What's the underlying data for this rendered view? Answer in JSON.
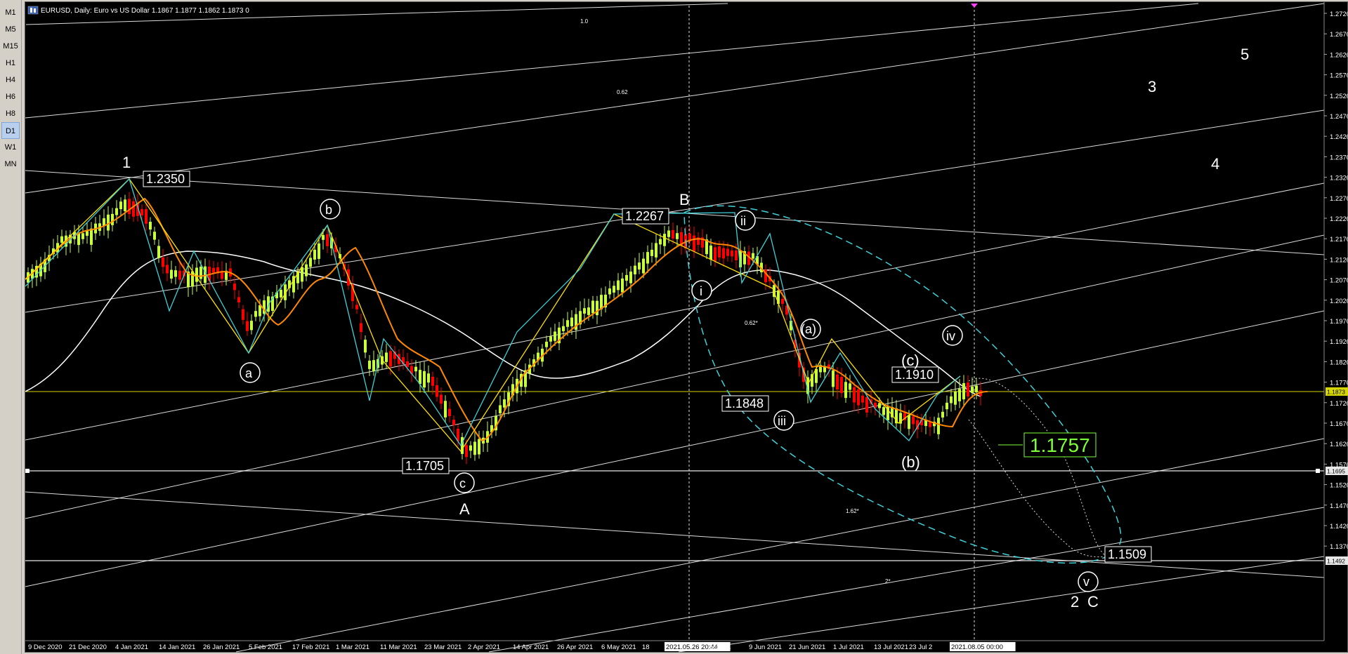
{
  "header": {
    "title": "EURUSD, Daily:  Euro vs US Dollar  1.1867 1.1877 1.1862 1.1873  0"
  },
  "timeframes": [
    "M1",
    "M5",
    "M15",
    "H1",
    "H4",
    "H6",
    "H8",
    "D1",
    "W1",
    "MN"
  ],
  "active_timeframe": "D1",
  "colors": {
    "background": "#000000",
    "bull_candle": "#c8ff3c",
    "bear_candle": "#ff0000",
    "zigzag_yellow": "#ffe000",
    "zigzag_cyan": "#3fd0d8",
    "moving_average": "#ffffff",
    "price_line": "#d6d600",
    "projection_box": "#7dff3a"
  },
  "price_axis": [
    "1.2720",
    "1.2670",
    "1.2620",
    "1.2570",
    "1.2520",
    "1.2470",
    "1.2420",
    "1.2370",
    "1.2320",
    "1.2270",
    "1.2220",
    "1.2170",
    "1.2120",
    "1.2070",
    "1.2020",
    "1.1970",
    "1.1920",
    "1.1873",
    "1.1820",
    "1.1770",
    "1.1720",
    "1.1695",
    "1.1670",
    "1.1620",
    "1.1570",
    "1.1520",
    "1.1492",
    "1.1470",
    "1.1420",
    "1.1370"
  ],
  "time_axis": [
    "9 Dec 2020",
    "21 Dec 2020",
    "4 Jan 2021",
    "14 Jan 2021",
    "26 Jan 2021",
    "5 Feb 2021",
    "17 Feb 2021",
    "1 Mar 2021",
    "11 Mar 2021",
    "23 Mar 2021",
    "2 Apr 2021",
    "14 Apr 2021",
    "26 Apr 2021",
    "6 May 2021",
    "18",
    "2021.05.26 20:44",
    "y 2021",
    "9 Jun 2021",
    "21 Jun 2021",
    "1 Jul 2021",
    "13 Jul 2021",
    "23 Jul 2",
    "2021.08.05 00:00"
  ],
  "price_labels": {
    "p1": "1.2350",
    "pB": "1.2267",
    "pA": "1.1705",
    "p1848": "1.1848",
    "p1910": "1.1910",
    "target": "1.1757",
    "final": "1.1509"
  },
  "wave_labels": {
    "w1": "1",
    "wB": "B",
    "wA": "A",
    "w2": "2",
    "wC": "C",
    "w3": "3",
    "w4": "4",
    "w5": "5",
    "a": "a",
    "b": "b",
    "c": "c",
    "i": "i",
    "ii": "ii",
    "iii": "iii",
    "iv": "iv",
    "v": "v",
    "pa": "(a)",
    "pb": "(b)",
    "pc": "(c)"
  },
  "fib_labels": {
    "f1": "1.0",
    "f2": "0.62",
    "f3": "0.62*",
    "f4": "1.62*",
    "f5": "2*"
  }
}
